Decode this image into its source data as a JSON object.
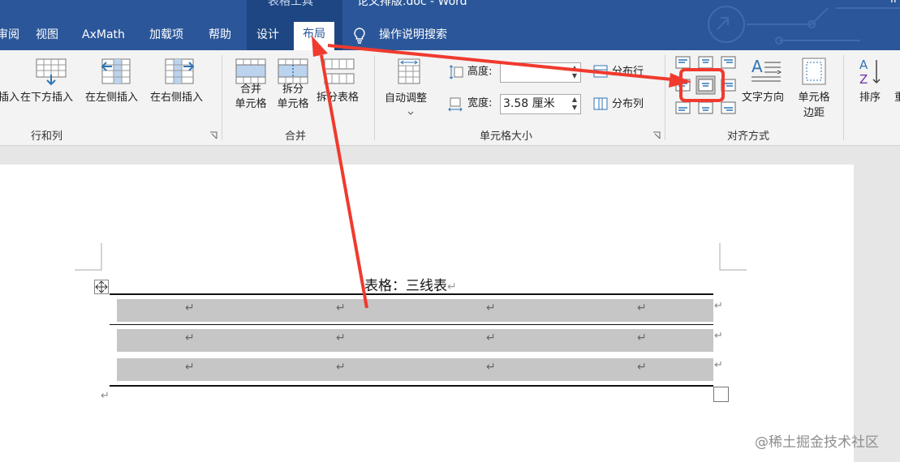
{
  "titlebar": {
    "context_group": "表格工具",
    "doc_title": "论文排版.doc  -  Word",
    "right_text": "li"
  },
  "tabs": [
    "审阅",
    "视图",
    "AxMath",
    "加载项",
    "帮助",
    "设计",
    "布局"
  ],
  "active_tab": "布局",
  "tell_me": "操作说明搜索",
  "ribbon": {
    "rows_columns": {
      "insert_above": "插入",
      "insert_below": "在下方插入",
      "insert_left": "在左侧插入",
      "insert_right": "在右侧插入",
      "group": "行和列"
    },
    "merge": {
      "merge_cells_1": "合并",
      "merge_cells_2": "单元格",
      "split_cells_1": "拆分",
      "split_cells_2": "单元格",
      "split_table": "拆分表格",
      "group": "合并"
    },
    "cell_size": {
      "autofit": "自动调整",
      "height_label": "高度:",
      "height_value": "",
      "width_label": "宽度:",
      "width_value": "3.58 厘米",
      "distribute_rows": "分布行",
      "distribute_cols": "分布列",
      "group": "单元格大小"
    },
    "alignment": {
      "text_direction": "文字方向",
      "cell_margins_1": "单元格",
      "cell_margins_2": "边距",
      "group": "对齐方式"
    },
    "data": {
      "sort": "排序",
      "next": "重"
    }
  },
  "document": {
    "caption": "表格：三线表",
    "paragraph_mark": "↵",
    "rows": 3,
    "cols": 4
  },
  "colors": {
    "word_blue": "#2b579a",
    "annotation_red": "#f03a2e",
    "row_shade": "#c6c6c6"
  },
  "watermark": "@稀土掘金技术社区"
}
